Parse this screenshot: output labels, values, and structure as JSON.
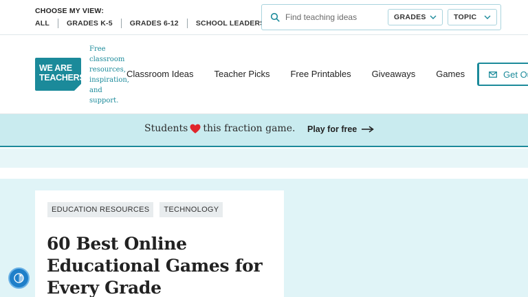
{
  "util_bar": {
    "view_title": "CHOOSE MY VIEW:",
    "grade_links": [
      "ALL",
      "GRADES K-5",
      "GRADES 6-12",
      "SCHOOL LEADERS"
    ],
    "search_placeholder": "Find teaching ideas",
    "filters": [
      "GRADES",
      "TOPIC"
    ]
  },
  "header": {
    "logo_line1": "WE ARE",
    "logo_line2": "TEACHERS",
    "tagline": "Free classroom resources, inspiration, and support.",
    "nav": [
      "Classroom Ideas",
      "Teacher Picks",
      "Free Printables",
      "Giveaways",
      "Games"
    ],
    "cta_label": "Get Ou"
  },
  "promo": {
    "text_before": "Students",
    "text_after": "this fraction game.",
    "link_label": "Play for free"
  },
  "article": {
    "tags": [
      "EDUCATION RESOURCES",
      "TECHNOLOGY"
    ],
    "title": "60 Best Online Educational Games for Every Grade"
  },
  "colors": {
    "brand_teal": "#1b8a9a",
    "banner_bg": "#c9ebef",
    "heart": "#e0262b",
    "accessibility": "#1f7fc9"
  },
  "icons": {
    "search": "search-icon",
    "chevron": "chevron-down-icon",
    "mail": "mail-icon",
    "heart": "heart-icon",
    "arrow": "arrow-right-icon",
    "accessibility": "accessibility-icon"
  }
}
